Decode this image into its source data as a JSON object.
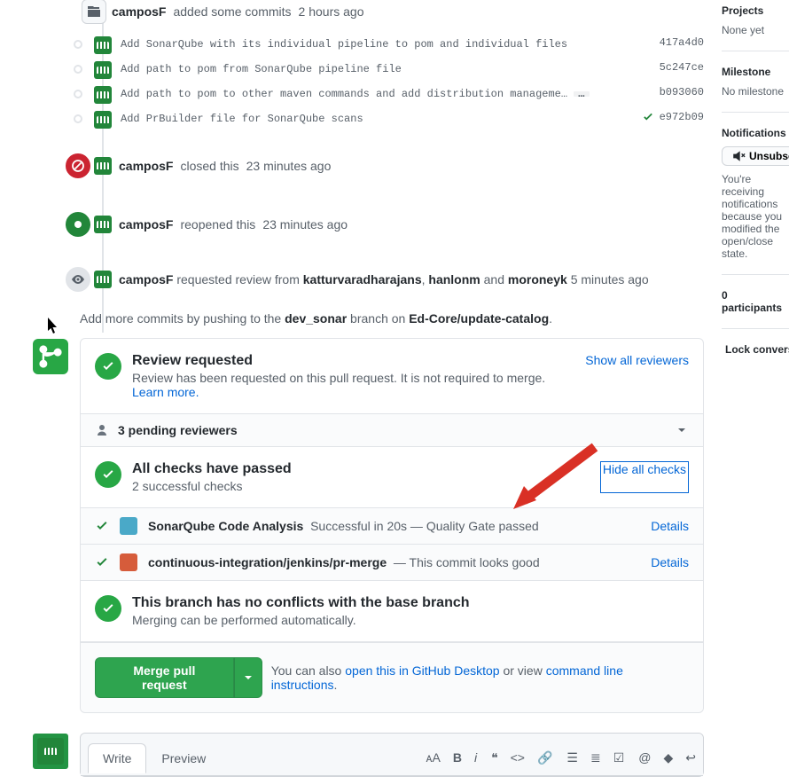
{
  "header_event": {
    "actor": "camposF",
    "action": "added some commits",
    "time": "2 hours ago"
  },
  "commits": [
    {
      "msg": "Add SonarQube with its individual pipeline to pom and individual files",
      "sha": "417a4d0",
      "check": false,
      "ellipsis": false
    },
    {
      "msg": "Add path to pom from SonarQube pipeline file",
      "sha": "5c247ce",
      "check": false,
      "ellipsis": false
    },
    {
      "msg": "Add path to pom to other maven commands and add distribution manageme…",
      "sha": "b093060",
      "check": false,
      "ellipsis": true
    },
    {
      "msg": "Add PrBuilder file for SonarQube scans",
      "sha": "e972b09",
      "check": true,
      "ellipsis": false
    }
  ],
  "events": {
    "closed": {
      "actor": "camposF",
      "text": "closed this",
      "time": "23 minutes ago"
    },
    "reopened": {
      "actor": "camposF",
      "text": "reopened this",
      "time": "23 minutes ago"
    },
    "review_req": {
      "actor": "camposF",
      "prefix": "requested review from",
      "r1": "katturvaradharajans",
      "r2": "hanlonm",
      "and": "and",
      "r3": "moroneyk",
      "time": "5 minutes ago"
    }
  },
  "push_hint": {
    "pre": "Add more commits by pushing to the ",
    "branch": "dev_sonar",
    "mid": " branch on ",
    "repo": "Ed-Core/update-catalog",
    "post": "."
  },
  "merge": {
    "review": {
      "title": "Review requested",
      "desc": "Review has been requested on this pull request. It is not required to merge. ",
      "learn": "Learn more.",
      "show_all": "Show all reviewers"
    },
    "pending": "3 pending reviewers",
    "checks": {
      "title": "All checks have passed",
      "sub": "2 successful checks",
      "hide": "Hide all checks"
    },
    "check_items": [
      {
        "name": "SonarQube Code Analysis",
        "desc": "Successful in 20s — Quality Gate passed",
        "details": "Details",
        "icon_color": "#4aa9c8"
      },
      {
        "name": "continuous-integration/jenkins/pr-merge",
        "desc": "— This commit looks good",
        "details": "Details",
        "icon_color": "#d65c3b"
      }
    ],
    "conflicts": {
      "title": "This branch has no conflicts with the base branch",
      "desc": "Merging can be performed automatically."
    },
    "action": {
      "btn": "Merge pull request",
      "txt_pre": "You can also ",
      "open_desktop": "open this in GitHub Desktop",
      "or_view": " or view ",
      "cli": "command line instructions",
      "dot": "."
    }
  },
  "comment": {
    "write": "Write",
    "preview": "Preview"
  },
  "sidebar": {
    "projects": {
      "h": "Projects",
      "v": "None yet"
    },
    "milestone": {
      "h": "Milestone",
      "v": "No milestone"
    },
    "notifications": {
      "h": "Notifications",
      "btn": "Unsubscribe",
      "desc": "You're receiving notifications because you modified the open/close state."
    },
    "participants": "0 participants",
    "lock": "Lock conversation"
  }
}
